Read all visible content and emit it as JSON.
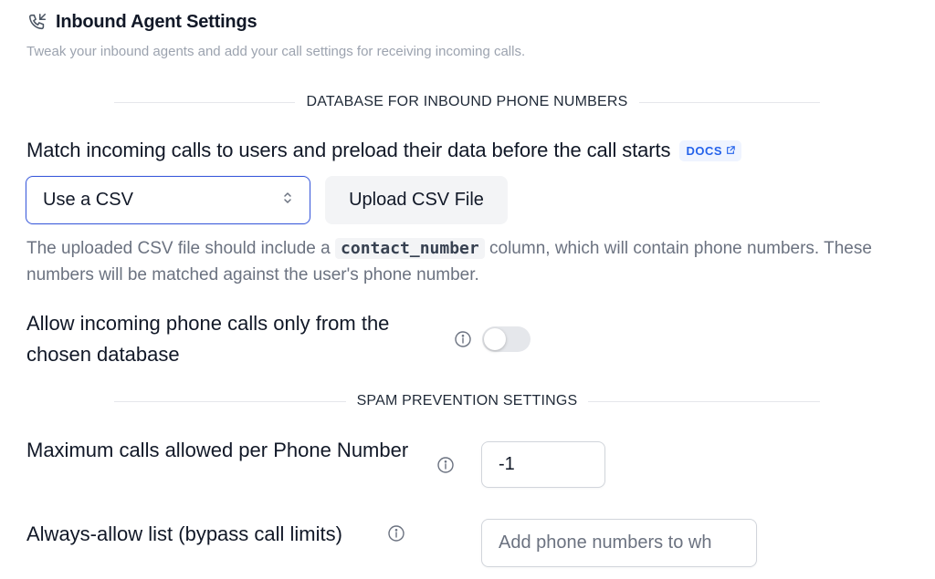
{
  "header": {
    "title": "Inbound Agent Settings",
    "subtitle": "Tweak your inbound agents and add your call settings for receiving incoming calls."
  },
  "database_section": {
    "divider_label": "DATABASE FOR INBOUND PHONE NUMBERS",
    "match_text": "Match incoming calls to users and preload their data before the call starts",
    "docs_label": "DOCS",
    "source_select": {
      "value": "Use a CSV"
    },
    "upload_button_label": "Upload CSV File",
    "helper_before": "The uploaded CSV file should include a ",
    "helper_code": "contact_number",
    "helper_after": " column, which will contain phone numbers. These numbers will be matched against the user's phone number.",
    "allow_only_label": "Allow incoming phone calls only from the chosen database",
    "allow_only_enabled": false
  },
  "spam_section": {
    "divider_label": "SPAM PREVENTION SETTINGS",
    "max_calls_label": "Maximum calls allowed per Phone Number",
    "max_calls_value": "-1",
    "allow_list_label": "Always-allow list (bypass call limits)",
    "allow_list_placeholder": "Add phone numbers to wh"
  },
  "colors": {
    "accent": "#3b5bdb",
    "docs_text": "#2563eb",
    "docs_bg": "#eff4ff",
    "muted_text": "#9ca3af"
  },
  "icons": {
    "header": "phone-incoming-icon",
    "select": "chevron-up-down-icon",
    "docs": "external-link-icon",
    "info": "info-icon"
  }
}
